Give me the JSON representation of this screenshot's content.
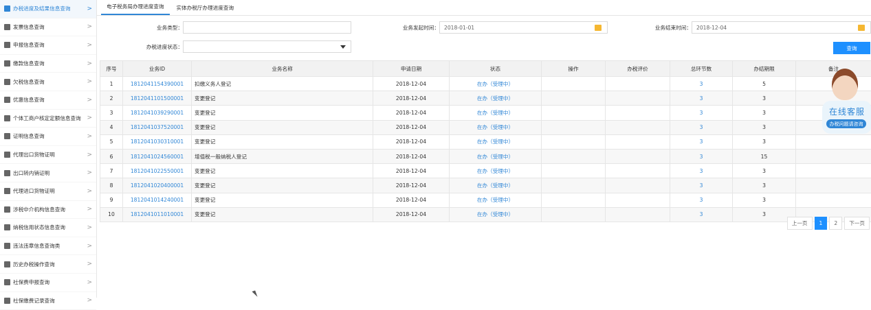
{
  "sidebar": {
    "items": [
      {
        "label": "办税进度及结果信息查询",
        "active": true
      },
      {
        "label": "发票信息查询"
      },
      {
        "label": "申报信息查询"
      },
      {
        "label": "缴款信息查询"
      },
      {
        "label": "欠税信息查询"
      },
      {
        "label": "优惠信息查询"
      },
      {
        "label": "个体工商户核定定额信息查询"
      },
      {
        "label": "证明信息查询"
      },
      {
        "label": "代理出口货物证明"
      },
      {
        "label": "出口转内销证明"
      },
      {
        "label": "代理进口货物证明"
      },
      {
        "label": "涉税中介机构信息查询"
      },
      {
        "label": "纳税信用状态信息查询"
      },
      {
        "label": "违法违章信息查询类"
      },
      {
        "label": "历史办税操作查询"
      },
      {
        "label": "社保费申报查询"
      },
      {
        "label": "社保缴费记录查询"
      }
    ],
    "arrow": ">"
  },
  "tabs": [
    "电子税务局办理进度查询",
    "实体办税厅办理进度查询"
  ],
  "form": {
    "business_type_label": "业务类型：",
    "business_type_value": "",
    "start_time_label": "业务发起时间：",
    "start_time_value": "2018-01-01",
    "end_time_label": "业务结束时间：",
    "end_time_value": "2018-12-04",
    "status_label": "办税进度状态：",
    "status_value": "",
    "query_button": "查询"
  },
  "table": {
    "headers": [
      "序号",
      "业务ID",
      "业务名称",
      "申请日期",
      "状态",
      "操作",
      "办税评价",
      "总环节数",
      "办结期限",
      "备注"
    ],
    "rows": [
      [
        "1",
        "1812041154390001",
        "扣缴义务人登记",
        "2018-12-04",
        "在办（受理中）",
        "",
        "",
        "3",
        "5",
        ""
      ],
      [
        "2",
        "1812041101500001",
        "变更登记",
        "2018-12-04",
        "在办（受理中）",
        "",
        "",
        "3",
        "3",
        ""
      ],
      [
        "3",
        "1812041039290001",
        "变更登记",
        "2018-12-04",
        "在办（受理中）",
        "",
        "",
        "3",
        "3",
        ""
      ],
      [
        "4",
        "1812041037520001",
        "变更登记",
        "2018-12-04",
        "在办（受理中）",
        "",
        "",
        "3",
        "3",
        ""
      ],
      [
        "5",
        "1812041030310001",
        "变更登记",
        "2018-12-04",
        "在办（受理中）",
        "",
        "",
        "3",
        "3",
        ""
      ],
      [
        "6",
        "1812041024560001",
        "增值税一般纳税人登记",
        "2018-12-04",
        "在办（受理中）",
        "",
        "",
        "3",
        "15",
        ""
      ],
      [
        "7",
        "1812041022550001",
        "变更登记",
        "2018-12-04",
        "在办（受理中）",
        "",
        "",
        "3",
        "3",
        ""
      ],
      [
        "8",
        "1812041020400001",
        "变更登记",
        "2018-12-04",
        "在办（受理中）",
        "",
        "",
        "3",
        "3",
        ""
      ],
      [
        "9",
        "1812041014240001",
        "变更登记",
        "2018-12-04",
        "在办（受理中）",
        "",
        "",
        "3",
        "3",
        ""
      ],
      [
        "10",
        "1812041011010001",
        "变更登记",
        "2018-12-04",
        "在办（受理中）",
        "",
        "",
        "3",
        "3",
        ""
      ]
    ]
  },
  "pager": {
    "prev": "上一页",
    "pages": [
      "1",
      "2"
    ],
    "current": "1",
    "next": "下一页"
  },
  "cs": {
    "title": "在线客服",
    "sub": "办税问题请咨询"
  },
  "colors": {
    "accent": "#2f86d6",
    "button": "#1e90ff",
    "calendar": "#f5b731"
  }
}
